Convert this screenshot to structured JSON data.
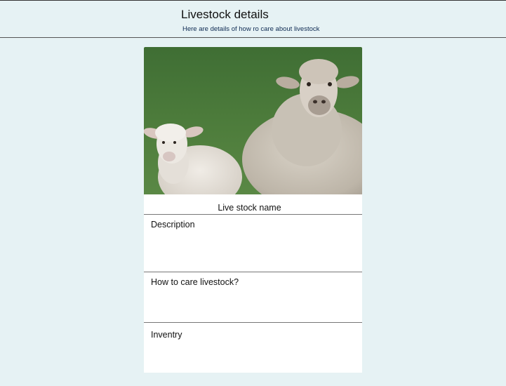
{
  "header": {
    "title": "Livestock details",
    "subtitle": "Here are details of how ro care about livestock"
  },
  "card": {
    "image_icon": "sheep-photo",
    "name_label": "Live stock name",
    "description_label": "Description",
    "care_label": "How to care livestock?",
    "inventory_label": "Inventry"
  },
  "colors": {
    "page_background": "#e6f2f4",
    "card_background": "#ffffff",
    "subtitle_text": "#0e2a52",
    "divider": "#777777"
  }
}
